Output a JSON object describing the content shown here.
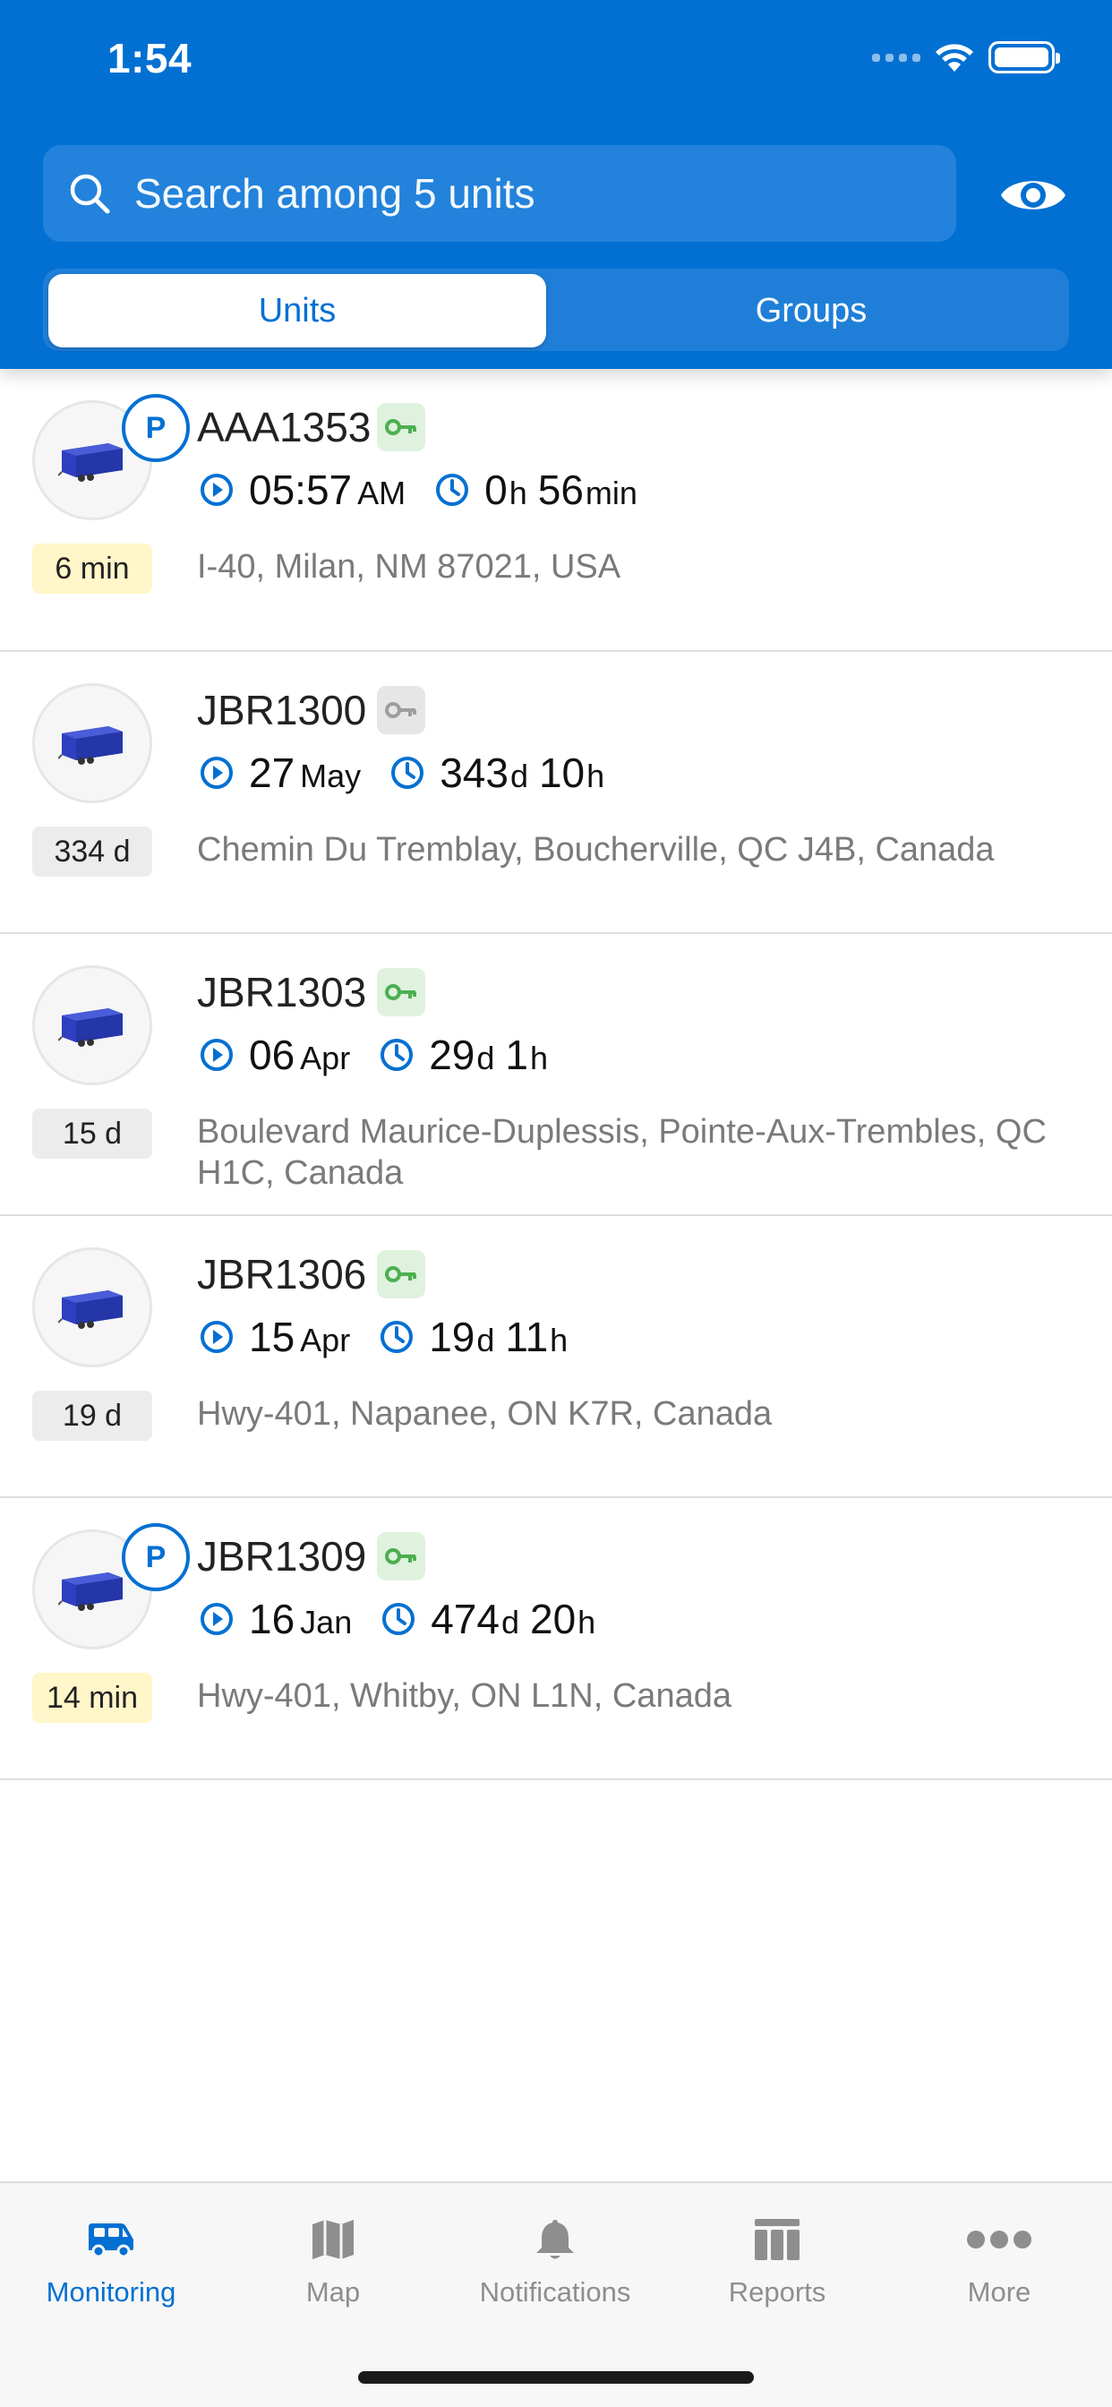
{
  "status_bar": {
    "time": "1:54"
  },
  "search": {
    "placeholder": "Search among 5 units"
  },
  "segments": {
    "units": "Units",
    "groups": "Groups"
  },
  "units": [
    {
      "name": "AAA1353",
      "ignition": "on",
      "parked": true,
      "age": "6 min",
      "age_style": "yellow",
      "time_value": "05:57",
      "time_unit": "AM",
      "dur1_value": "0",
      "dur1_unit": "h",
      "dur2_value": "56",
      "dur2_unit": "min",
      "address": "I-40, Milan, NM 87021, USA"
    },
    {
      "name": "JBR1300",
      "ignition": "off",
      "parked": false,
      "age": "334 d",
      "age_style": "gray",
      "time_value": "27",
      "time_unit": "May",
      "dur1_value": "343",
      "dur1_unit": "d",
      "dur2_value": "10",
      "dur2_unit": "h",
      "address": "Chemin Du Tremblay, Boucherville, QC J4B, Canada"
    },
    {
      "name": "JBR1303",
      "ignition": "on",
      "parked": false,
      "age": "15 d",
      "age_style": "gray",
      "time_value": "06",
      "time_unit": "Apr",
      "dur1_value": "29",
      "dur1_unit": "d",
      "dur2_value": "1",
      "dur2_unit": "h",
      "address": "Boulevard Maurice-Duplessis, Pointe-Aux-Trembles, QC H1C, Canada"
    },
    {
      "name": "JBR1306",
      "ignition": "on",
      "parked": false,
      "age": "19 d",
      "age_style": "gray",
      "time_value": "15",
      "time_unit": "Apr",
      "dur1_value": "19",
      "dur1_unit": "d",
      "dur2_value": "11",
      "dur2_unit": "h",
      "address": "Hwy-401, Napanee, ON K7R, Canada"
    },
    {
      "name": "JBR1309",
      "ignition": "on",
      "parked": true,
      "age": "14 min",
      "age_style": "yellow",
      "time_value": "16",
      "time_unit": "Jan",
      "dur1_value": "474",
      "dur1_unit": "d",
      "dur2_value": "20",
      "dur2_unit": "h",
      "address": "Hwy-401, Whitby, ON L1N, Canada"
    }
  ],
  "parked_badge": "P",
  "tabs": [
    {
      "label": "Monitoring",
      "icon": "truck-icon",
      "active": true
    },
    {
      "label": "Map",
      "icon": "map-icon",
      "active": false
    },
    {
      "label": "Notifications",
      "icon": "bell-icon",
      "active": false
    },
    {
      "label": "Reports",
      "icon": "reports-icon",
      "active": false
    },
    {
      "label": "More",
      "icon": "more-icon",
      "active": false
    }
  ],
  "colors": {
    "brand_blue": "#0270d2",
    "key_on": "#4caf50",
    "key_off": "#9e9e9e",
    "age_recent": "#fff6c9",
    "age_old": "#ececec",
    "trailer": "#2f3fbf"
  }
}
